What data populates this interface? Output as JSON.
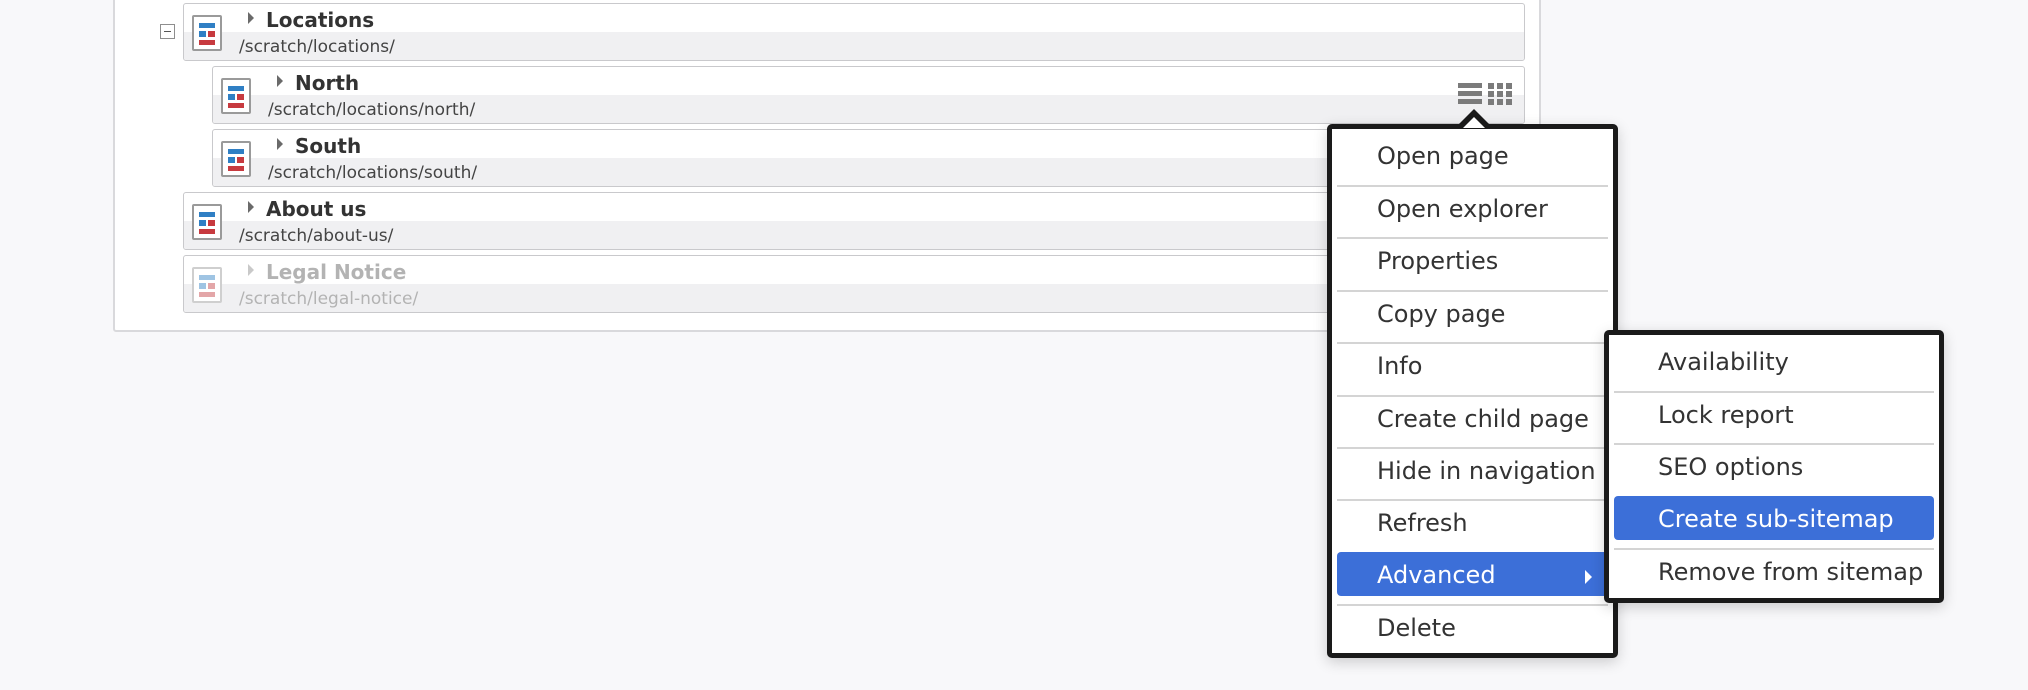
{
  "tree": {
    "nodes": [
      {
        "title": "Locations",
        "path": "/scratch/locations/"
      },
      {
        "title": "North",
        "path": "/scratch/locations/north/"
      },
      {
        "title": "South",
        "path": "/scratch/locations/south/"
      },
      {
        "title": "About us",
        "path": "/scratch/about-us/"
      },
      {
        "title": "Legal Notice",
        "path": "/scratch/legal-notice/",
        "hidden": true
      }
    ]
  },
  "context_menu": {
    "items": [
      {
        "label": "Open page"
      },
      {
        "label": "Open explorer"
      },
      {
        "label": "Properties"
      },
      {
        "label": "Copy page"
      },
      {
        "label": "Info"
      },
      {
        "label": "Create child page"
      },
      {
        "label": "Hide in navigation"
      },
      {
        "label": "Refresh"
      },
      {
        "label": "Advanced",
        "highlighted": true,
        "has_submenu": true
      },
      {
        "label": "Delete"
      }
    ],
    "submenu": {
      "parent": "Advanced",
      "items": [
        {
          "label": "Availability"
        },
        {
          "label": "Lock report"
        },
        {
          "label": "SEO options"
        },
        {
          "label": "Create sub-sitemap",
          "highlighted": true
        },
        {
          "label": "Remove from sitemap"
        }
      ]
    }
  },
  "colors": {
    "highlight": "#3c6fd8",
    "icon_blue": "#2f7fc4",
    "icon_red": "#c73a3f",
    "menu_border": "#1a1a1a"
  },
  "icons": {
    "collapse": "minus-square-icon",
    "page": "page-icon",
    "expand": "caret-right-icon",
    "list_view": "list-view-icon",
    "grid_view": "grid-view-icon",
    "submenu": "chevron-right-icon"
  }
}
